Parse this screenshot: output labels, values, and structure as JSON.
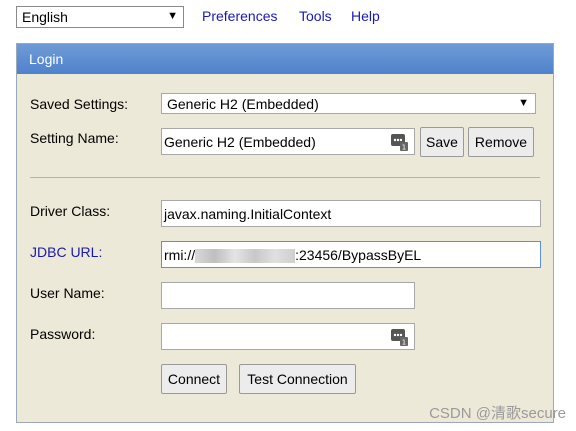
{
  "topbar": {
    "language": "English",
    "links": [
      "Preferences",
      "Tools",
      "Help"
    ]
  },
  "login": {
    "title": "Login",
    "saved_settings_label": "Saved Settings:",
    "saved_settings_value": "Generic H2 (Embedded)",
    "setting_name_label": "Setting Name:",
    "setting_name_value": "Generic H2 (Embedded)",
    "save_label": "Save",
    "remove_label": "Remove",
    "driver_class_label": "Driver Class:",
    "driver_class_value": "javax.naming.InitialContext",
    "jdbc_url_label": "JDBC URL:",
    "jdbc_url_prefix": "rmi://",
    "jdbc_url_suffix": ":23456/BypassByEL",
    "user_name_label": "User Name:",
    "user_name_value": "",
    "password_label": "Password:",
    "password_value": "",
    "connect_label": "Connect",
    "test_connection_label": "Test Connection"
  },
  "watermark": "CSDN @清歌secure",
  "colors": {
    "header_blue": "#5a8bd0",
    "panel_bg": "#ece9d8",
    "link_blue": "#1a1ab0"
  }
}
